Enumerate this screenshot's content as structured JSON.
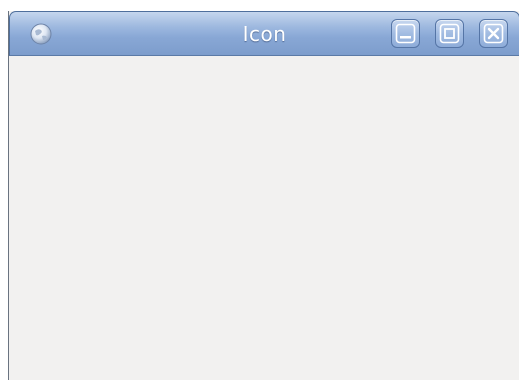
{
  "window": {
    "title": "Icon",
    "app_icon": "globe-icon",
    "controls": {
      "minimize": "minimize-icon",
      "maximize": "maximize-icon",
      "close": "close-icon"
    }
  },
  "colors": {
    "titlebar": "#88a7d5",
    "content_background": "#f2f1f0",
    "title_text": "#ffffff"
  }
}
